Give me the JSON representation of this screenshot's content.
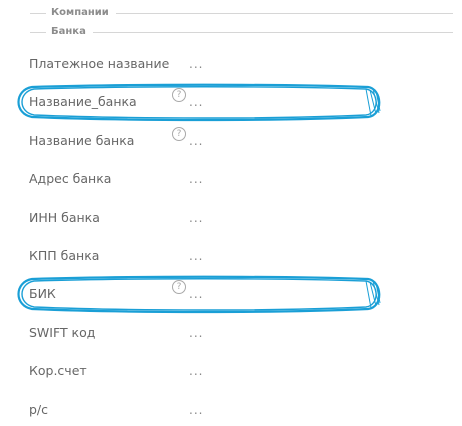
{
  "sections": {
    "companies": "Компании",
    "bank": "Банка"
  },
  "fields": [
    {
      "label": "Платежное название",
      "value": "...",
      "help": false
    },
    {
      "label": "Название_банка",
      "value": "...",
      "help": true,
      "help_glyph": "?"
    },
    {
      "label": "Название банка",
      "value": "...",
      "help": true,
      "help_glyph": "?"
    },
    {
      "label": "Адрес банка",
      "value": "...",
      "help": false
    },
    {
      "label": "ИНН банка",
      "value": "...",
      "help": false
    },
    {
      "label": "КПП банка",
      "value": "...",
      "help": false
    },
    {
      "label": "БИК",
      "value": "...",
      "help": true,
      "help_glyph": "?"
    },
    {
      "label": "SWIFT код",
      "value": "...",
      "help": false
    },
    {
      "label": "Кор.счет",
      "value": "...",
      "help": false
    },
    {
      "label": "р/с",
      "value": "...",
      "help": false
    }
  ],
  "annotations": {
    "color": "#1a9fd6",
    "highlighted_fields": [
      "Название_банка",
      "БИК"
    ]
  }
}
